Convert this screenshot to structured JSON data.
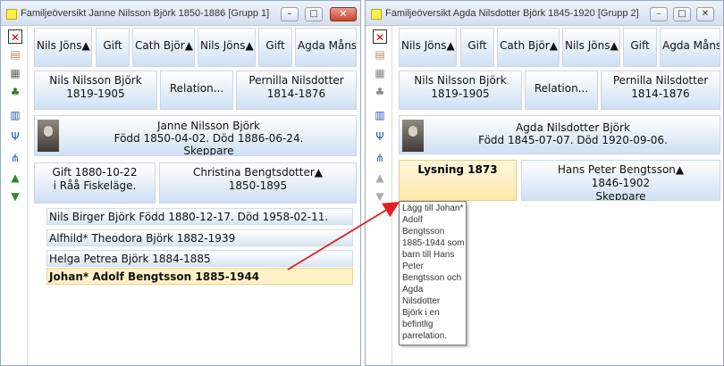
{
  "colors": {
    "accent_blue_gradient": "#cfe0f3",
    "selected_child": "#fff2c7",
    "lysning": "#ffe7aa",
    "arrow": "#e02020",
    "close_button": "#c8442b"
  },
  "left": {
    "title": "Familjeöversikt Janne Nilsson Björk 1850-1886 [Grupp 1]",
    "grandparents": [
      "Nils Jöns▲",
      "Gift",
      "Cath Björ▲",
      "Nils Jöns▲",
      "Gift",
      "Agda Måns"
    ],
    "father": {
      "name": "Nils Nilsson Björk",
      "dates": "1819-1905"
    },
    "relation": "Relation...",
    "mother": {
      "name": "Pernilla Nilsdotter",
      "dates": "1814-1876"
    },
    "focus": {
      "name": "Janne Nilsson Björk",
      "dates": "Född 1850-04-02. Död 1886-06-24.",
      "occupation": "Skeppare"
    },
    "marriage": {
      "line1": "Gift 1880-10-22",
      "line2": "i  Råå Fiskeläge."
    },
    "spouse": {
      "name": "Christina Bengtsdotter▲",
      "dates": "1850-1895"
    },
    "children": [
      "Nils Birger Björk Född 1880-12-17. Död 1958-02-11.",
      "Alfhild* Theodora Björk 1882-1939",
      "Helga Petrea Björk 1884-1885",
      "Johan* Adolf Bengtsson 1885-1944"
    ]
  },
  "right": {
    "title": "Familjeöversikt Agda Nilsdotter Björk 1845-1920 [Grupp 2]",
    "grandparents": [
      "Nils Jöns▲",
      "Gift",
      "Cath Björ▲",
      "Nils Jöns▲",
      "Gift",
      "Agda Måns"
    ],
    "father": {
      "name": "Nils Nilsson Björk",
      "dates": "1819-1905"
    },
    "relation": "Relation...",
    "mother": {
      "name": "Pernilla Nilsdotter",
      "dates": "1814-1876"
    },
    "focus": {
      "name": "Agda Nilsdotter Björk",
      "dates": "Född 1845-07-07. Död 1920-09-06."
    },
    "lysning": "Lysning 1873",
    "spouse": {
      "name": "Hans Peter Bengtsson▲",
      "dates": "1846-1902",
      "occupation": "Skeppare"
    },
    "tooltip_lines": [
      "Lägg till Johan*",
      "Adolf",
      "Bengtsson",
      "1885-1944 som",
      "barn till Hans",
      "Peter",
      "Bengtsson och",
      "Agda",
      "Nilsdotter",
      "Björk i en",
      "befintlig",
      "parrelation."
    ]
  },
  "window_buttons": {
    "minimize": "–",
    "maximize": "□",
    "close": "✕"
  },
  "toolbar_icons": [
    "delete-icon",
    "document-icon",
    "table-icon",
    "family-group-icon",
    "book-icon",
    "tree-icon",
    "hierarchy-icon",
    "person-up-icon",
    "person-down-icon"
  ]
}
